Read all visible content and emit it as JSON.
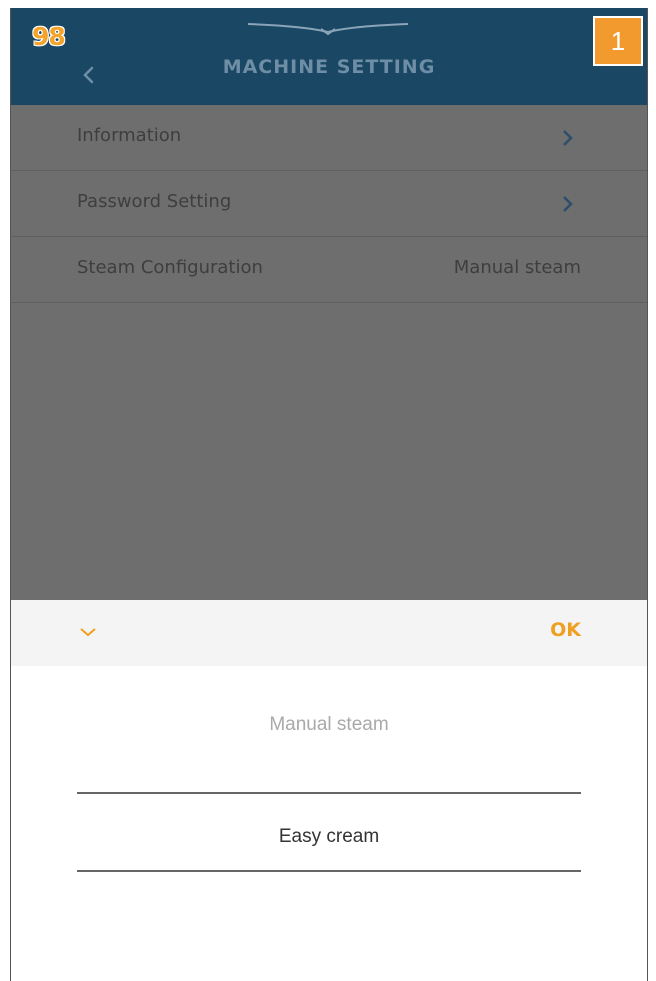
{
  "page_number": "98",
  "step_badge": "1",
  "header": {
    "title": "MACHINE SETTING"
  },
  "settings": {
    "items": [
      {
        "label": "Information",
        "value": ""
      },
      {
        "label": "Password Setting",
        "value": ""
      },
      {
        "label": "Steam Configuration",
        "value": "Manual steam"
      }
    ]
  },
  "picker": {
    "ok_label": "OK",
    "options": [
      "Manual steam",
      "Easy cream"
    ],
    "selected": "Easy cream"
  },
  "colors": {
    "header_bg": "#1a4764",
    "accent": "#f29a2e",
    "overlay": "#6e6e6e"
  }
}
